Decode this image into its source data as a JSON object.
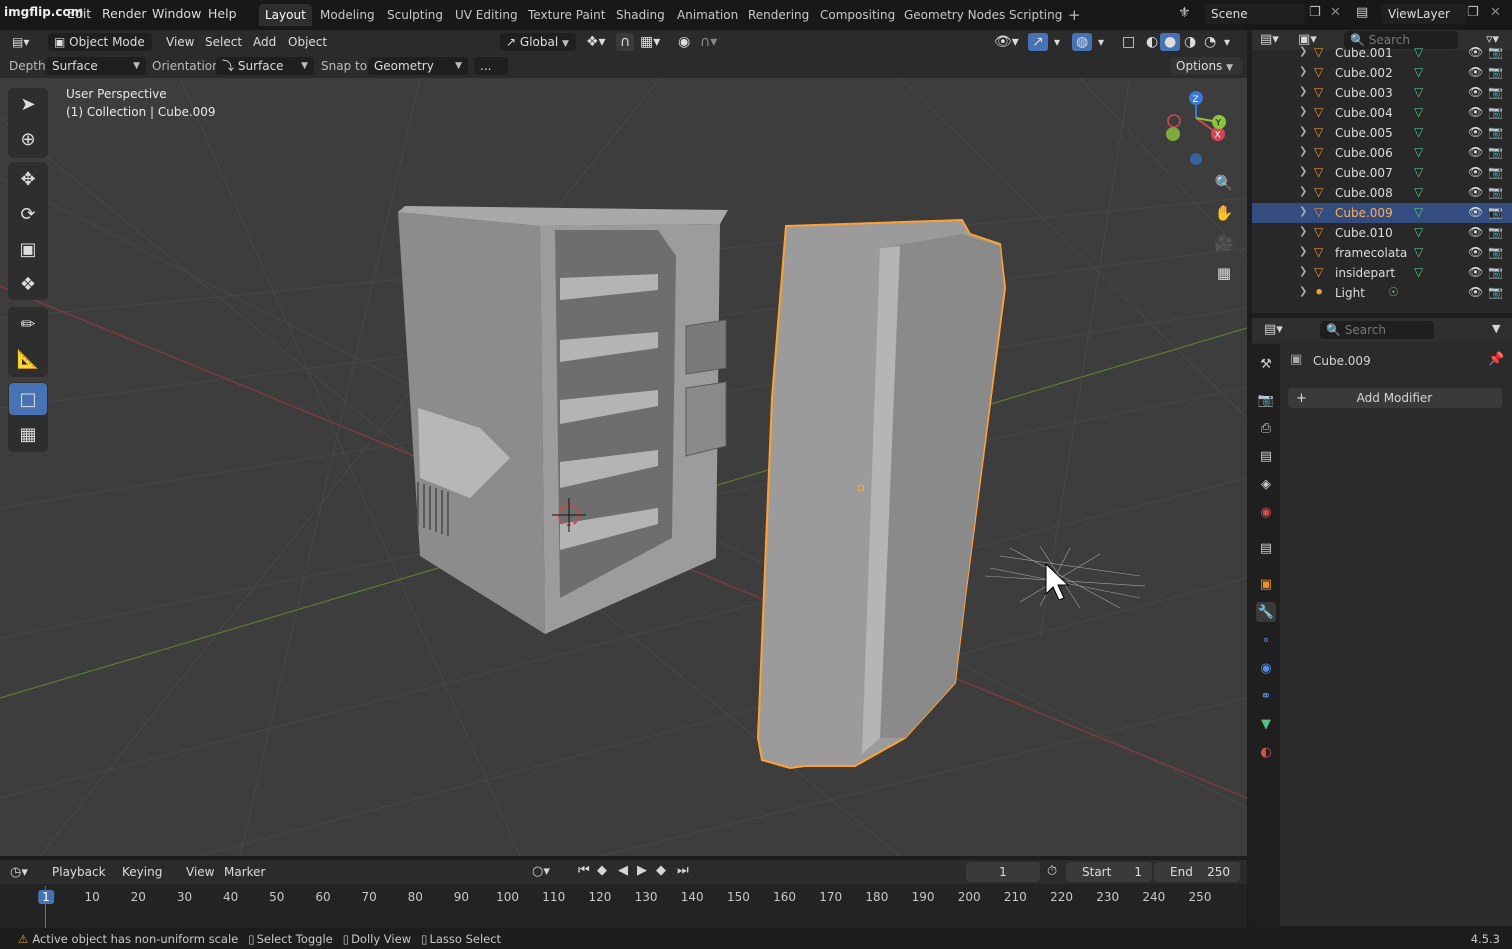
{
  "watermark": "imgflip.com",
  "menu": [
    "File",
    "Edit",
    "Render",
    "Window",
    "Help"
  ],
  "workspaces": [
    "Layout",
    "Modeling",
    "Sculpting",
    "UV Editing",
    "Texture Paint",
    "Shading",
    "Animation",
    "Rendering",
    "Compositing",
    "Geometry Nodes",
    "Scripting"
  ],
  "active_workspace": "Layout",
  "scene_name": "Scene",
  "view_layer": "ViewLayer",
  "header": {
    "mode": "Object Mode",
    "view": "View",
    "select": "Select",
    "add": "Add",
    "object": "Object",
    "transform_orientation": "Global"
  },
  "tool_settings": {
    "depth_label": "Depth:",
    "depth_value": "Surface",
    "orientation_label": "Orientation:",
    "orientation_value": "Surface",
    "snap_label": "Snap to:",
    "snap_value": "Geometry",
    "more": "...",
    "options": "Options"
  },
  "viewport": {
    "perspective": "User Perspective",
    "context": "(1) Collection | Cube.009",
    "gizmo": {
      "x": "X",
      "y": "Y",
      "z": "Z"
    }
  },
  "outliner": {
    "search_placeholder": "Search",
    "items": [
      {
        "name": "Cube.001",
        "icon": "mesh-icon"
      },
      {
        "name": "Cube.002",
        "icon": "mesh-icon"
      },
      {
        "name": "Cube.003",
        "icon": "mesh-icon"
      },
      {
        "name": "Cube.004",
        "icon": "mesh-icon"
      },
      {
        "name": "Cube.005",
        "icon": "mesh-icon"
      },
      {
        "name": "Cube.006",
        "icon": "mesh-icon"
      },
      {
        "name": "Cube.007",
        "icon": "mesh-icon"
      },
      {
        "name": "Cube.008",
        "icon": "mesh-icon"
      },
      {
        "name": "Cube.009",
        "icon": "mesh-icon",
        "selected": true
      },
      {
        "name": "Cube.010",
        "icon": "mesh-icon"
      },
      {
        "name": "framecolata",
        "icon": "mesh-icon"
      },
      {
        "name": "insidepart",
        "icon": "mesh-icon"
      },
      {
        "name": "Light",
        "icon": "light-icon"
      }
    ]
  },
  "properties": {
    "search_placeholder": "Search",
    "object_name": "Cube.009",
    "add_modifier": "Add Modifier"
  },
  "timeline": {
    "playback": "Playback",
    "keying": "Keying",
    "view": "View",
    "marker": "Marker",
    "current_frame": "1",
    "start_label": "Start",
    "start_value": "1",
    "end_label": "End",
    "end_value": "250",
    "ticks": [
      "1",
      "10",
      "20",
      "30",
      "40",
      "50",
      "60",
      "70",
      "80",
      "90",
      "100",
      "110",
      "120",
      "130",
      "140",
      "150",
      "160",
      "170",
      "180",
      "190",
      "200",
      "210",
      "220",
      "230",
      "240",
      "250"
    ]
  },
  "status": {
    "message": "Active object has non-uniform scale",
    "hint1": "Select Toggle",
    "hint2": "Dolly View",
    "hint3": "Lasso Select",
    "version": "4.5.3"
  },
  "colors": {
    "selection_outline": "#ffa033",
    "selected_row": "#334d80",
    "active_tool": "#4772b3",
    "axis_x": "#d64556",
    "axis_y": "#8cc63e",
    "axis_z": "#3b78d8"
  }
}
